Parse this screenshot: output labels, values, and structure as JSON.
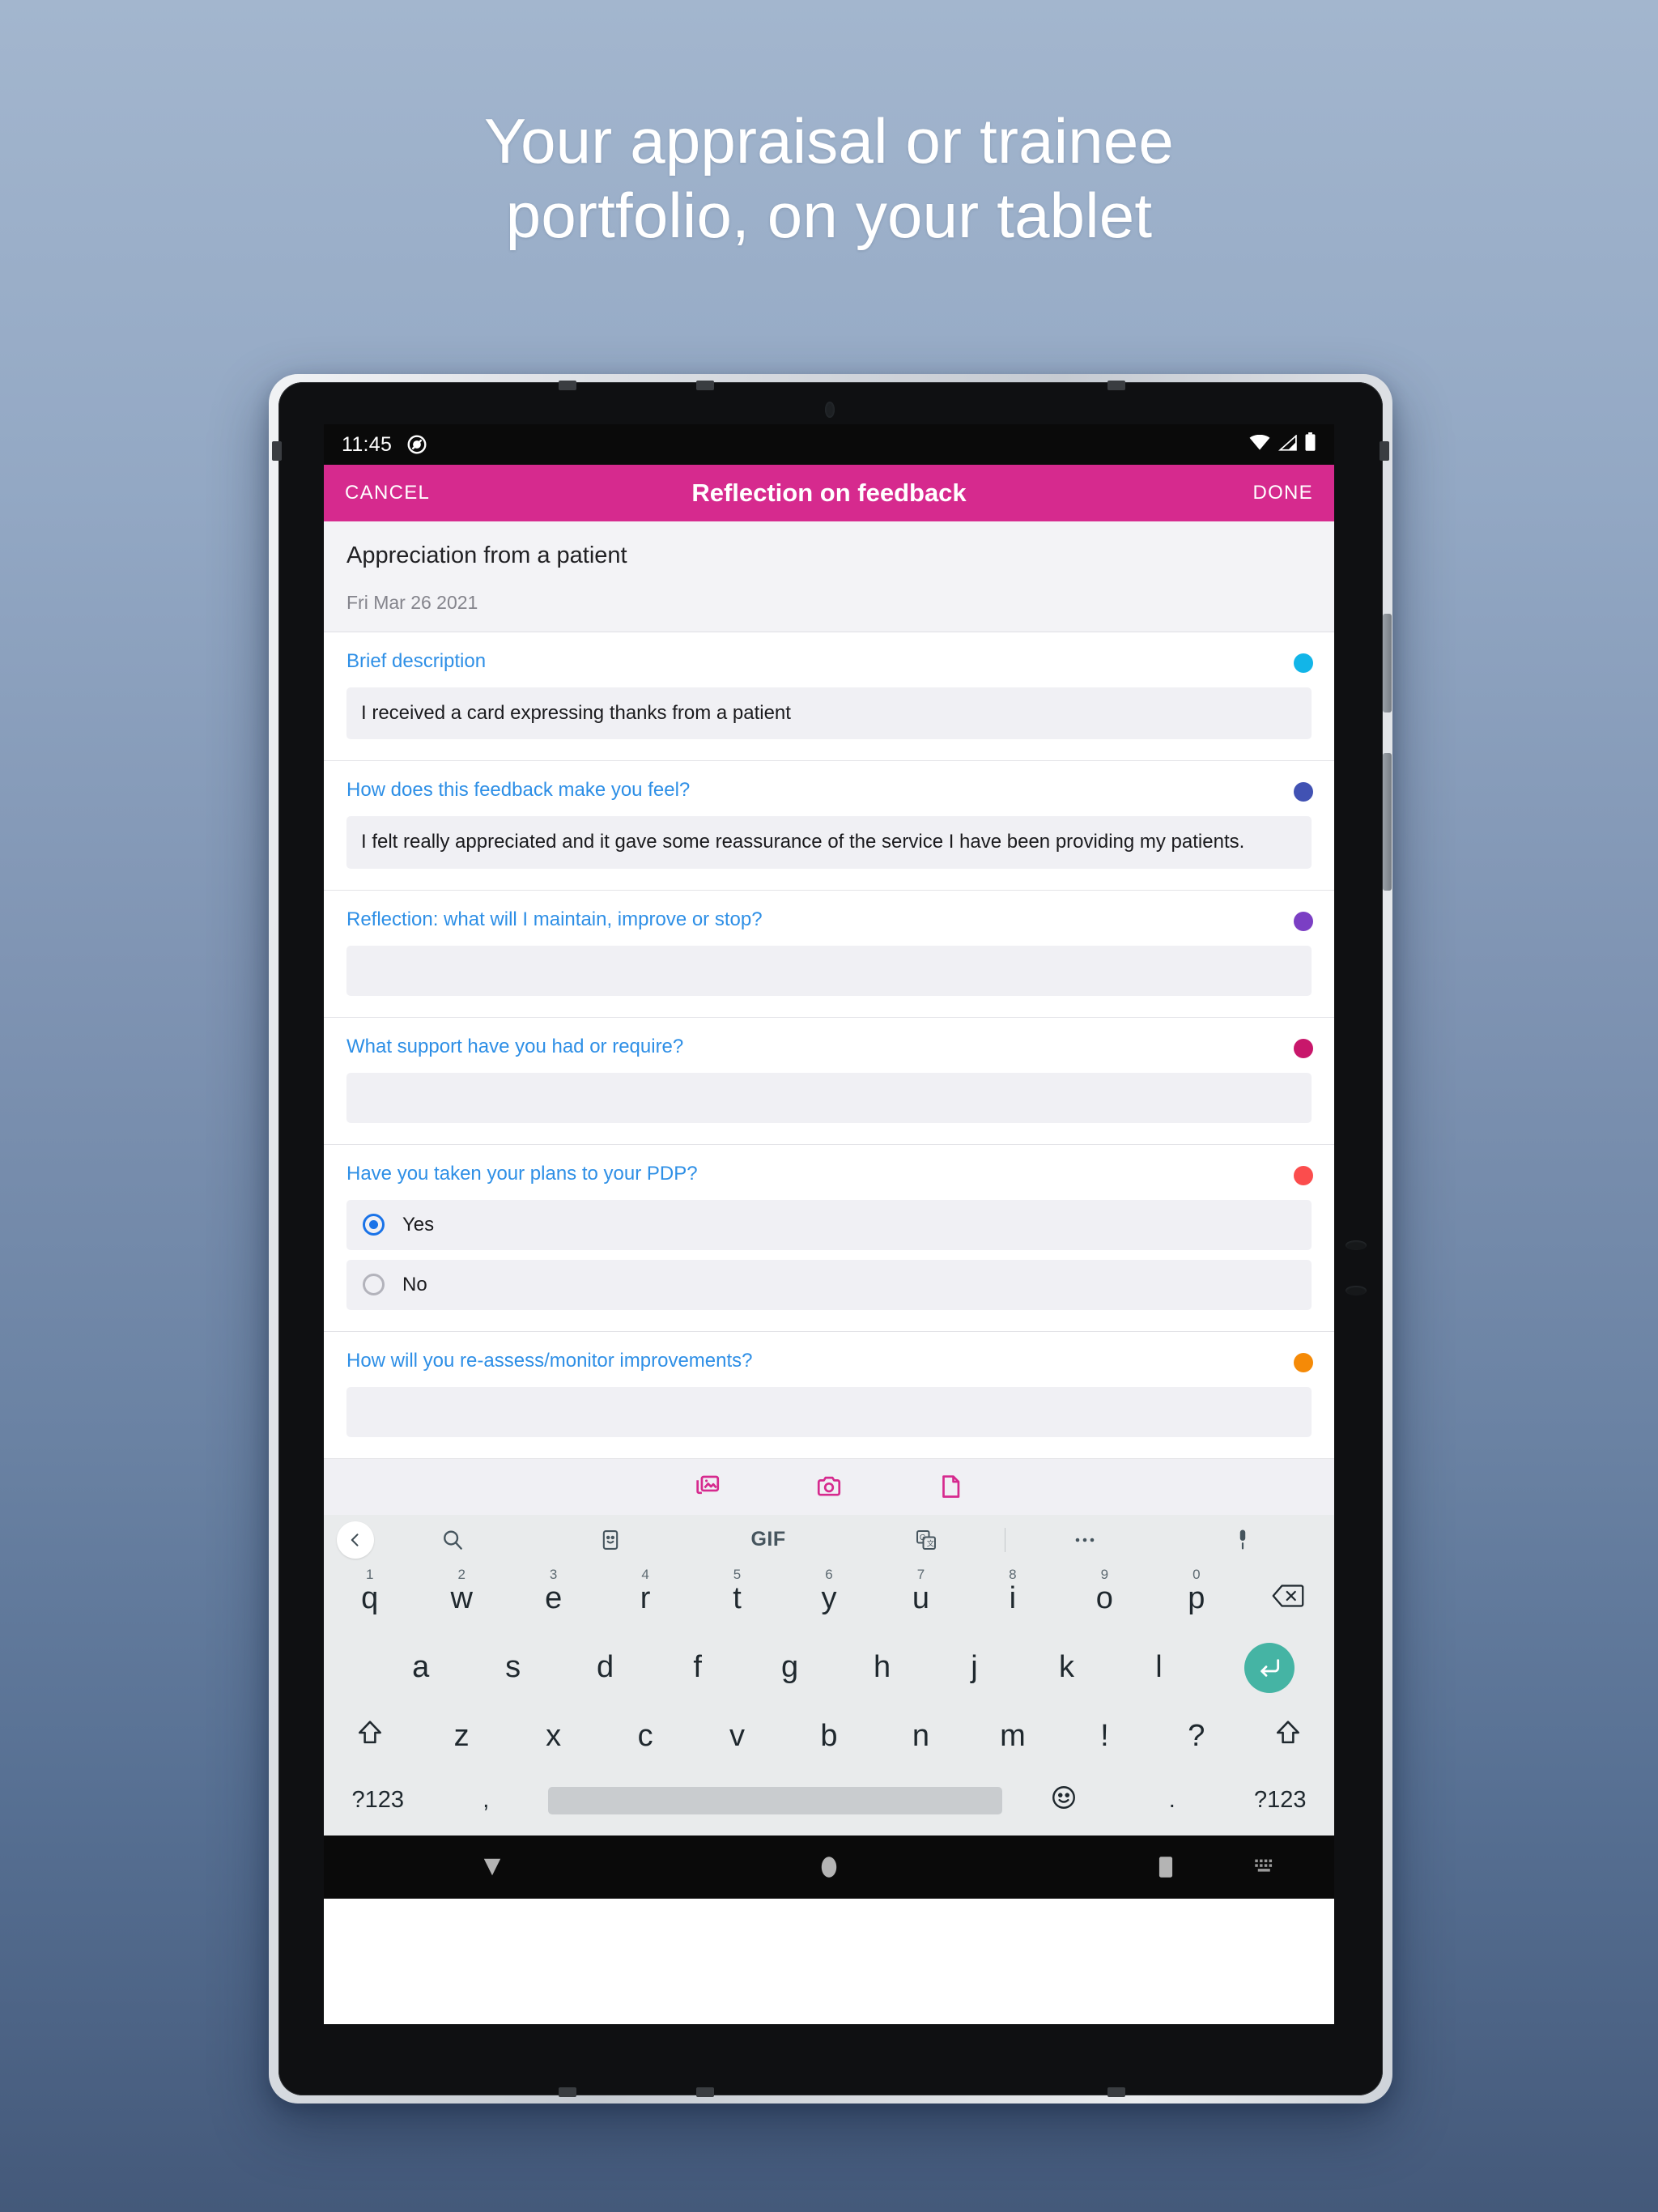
{
  "headline": {
    "line1": "Your appraisal or trainee",
    "line2": "portfolio, on your tablet"
  },
  "statusbar": {
    "time": "11:45",
    "left_icon": "do-not-disturb-icon",
    "icons": [
      "wifi-icon",
      "cellular-signal-icon",
      "battery-icon"
    ]
  },
  "appbar": {
    "cancel_label": "CANCEL",
    "title": "Reflection on feedback",
    "done_label": "DONE",
    "color": "#d62a8e"
  },
  "record": {
    "title": "Appreciation from a patient",
    "date": "Fri Mar 26 2021"
  },
  "form": {
    "sections": [
      {
        "label": "Brief description",
        "value": "I received a card expressing thanks from a patient",
        "dot_color": "#12b5e8",
        "type": "text"
      },
      {
        "label": "How does this feedback make you feel?",
        "value": "I felt really appreciated and it gave some reassurance of the service I have been providing my patients.",
        "dot_color": "#4152b3",
        "type": "text"
      },
      {
        "label": "Reflection: what will I maintain, improve or stop?",
        "value": "",
        "dot_color": "#7b3fc4",
        "type": "text"
      },
      {
        "label": "What support have you had or require?",
        "value": "",
        "dot_color": "#c8176b",
        "type": "text"
      },
      {
        "label": "Have you taken your plans to your PDP?",
        "value": "Yes",
        "dot_color": "#fb4d4d",
        "type": "radio",
        "options": [
          {
            "label": "Yes",
            "selected": true
          },
          {
            "label": "No",
            "selected": false
          }
        ]
      },
      {
        "label": "How will you re-assess/monitor improvements?",
        "value": "",
        "dot_color": "#f58a07",
        "type": "text"
      }
    ]
  },
  "attachments": {
    "color": "#d62a8e",
    "buttons": [
      {
        "name": "photo-library-icon",
        "label": "Gallery"
      },
      {
        "name": "camera-icon",
        "label": "Camera"
      },
      {
        "name": "document-icon",
        "label": "Document"
      }
    ]
  },
  "keyboard": {
    "toolbar": {
      "back": "chevron-left-icon",
      "items": [
        "search-icon",
        "sticker-icon",
        "GIF",
        "translate-icon",
        "more-icon",
        "microphone-icon"
      ],
      "gif_label": "GIF"
    },
    "row1": [
      {
        "key": "q",
        "num": "1"
      },
      {
        "key": "w",
        "num": "2"
      },
      {
        "key": "e",
        "num": "3"
      },
      {
        "key": "r",
        "num": "4"
      },
      {
        "key": "t",
        "num": "5"
      },
      {
        "key": "y",
        "num": "6"
      },
      {
        "key": "u",
        "num": "7"
      },
      {
        "key": "i",
        "num": "8"
      },
      {
        "key": "o",
        "num": "9"
      },
      {
        "key": "p",
        "num": "0"
      }
    ],
    "backspace": "backspace-icon",
    "row2": [
      "a",
      "s",
      "d",
      "f",
      "g",
      "h",
      "j",
      "k",
      "l"
    ],
    "enter": "enter-icon",
    "row3": [
      "z",
      "x",
      "c",
      "v",
      "b",
      "n",
      "m",
      "!",
      "?"
    ],
    "shift": "shift-icon",
    "row4": {
      "symbols_left": "?123",
      "comma": ",",
      "space": "",
      "emoji": "emoji-icon",
      "period": ".",
      "symbols_right": "?123"
    }
  },
  "navbar": {
    "back": "down-arrow-icon",
    "home": "home-circle-icon",
    "recents": "square-icon",
    "keyboard_indicator": "keyboard-icon"
  }
}
